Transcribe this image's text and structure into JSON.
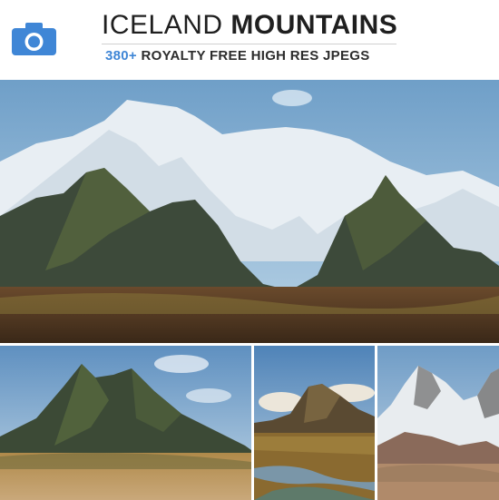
{
  "header": {
    "title_light": "ICELAND",
    "title_bold": "MOUNTAINS",
    "subtitle_count": "380+",
    "subtitle_rest": "ROYALTY FREE HIGH RES JPEGS",
    "icon": "camera-icon"
  },
  "colors": {
    "accent": "#3f86d6",
    "title": "#1f1f1f",
    "background": "#ffffff"
  },
  "photos": [
    {
      "id": "hero",
      "subject": "snow-capped mountain range"
    },
    {
      "id": "p1",
      "subject": "green mountain peak"
    },
    {
      "id": "p2",
      "subject": "mountain with stream"
    },
    {
      "id": "p3",
      "subject": "snowy peak"
    }
  ]
}
